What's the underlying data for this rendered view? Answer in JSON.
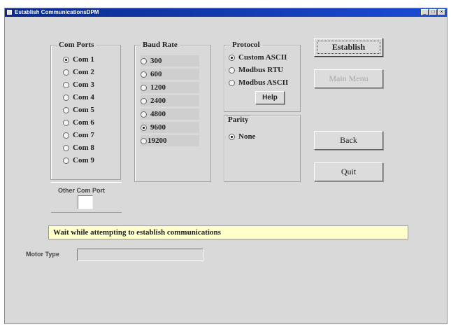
{
  "window": {
    "title": "Establish CommunicationsDPM",
    "controls": {
      "minimize": "_",
      "maximize": "□",
      "close": "×"
    }
  },
  "com_ports": {
    "label": "Com Ports",
    "items": [
      {
        "label": "Com 1",
        "checked": true
      },
      {
        "label": "Com 2",
        "checked": false
      },
      {
        "label": "Com 3",
        "checked": false
      },
      {
        "label": "Com 4",
        "checked": false
      },
      {
        "label": "Com 5",
        "checked": false
      },
      {
        "label": "Com 6",
        "checked": false
      },
      {
        "label": "Com 7",
        "checked": false
      },
      {
        "label": "Com 8",
        "checked": false
      },
      {
        "label": "Com 9",
        "checked": false
      }
    ]
  },
  "other_com_port": {
    "label": "Other Com Port",
    "value": ""
  },
  "baud_rate": {
    "label": "Baud Rate",
    "items": [
      {
        "label": "300",
        "checked": false
      },
      {
        "label": "600",
        "checked": false
      },
      {
        "label": "1200",
        "checked": false
      },
      {
        "label": "2400",
        "checked": false
      },
      {
        "label": "4800",
        "checked": false
      },
      {
        "label": "9600",
        "checked": true
      },
      {
        "label": "19200",
        "checked": false
      }
    ]
  },
  "protocol": {
    "label": "Protocol",
    "items": [
      {
        "label": "Custom ASCII",
        "checked": true
      },
      {
        "label": "Modbus RTU",
        "checked": false
      },
      {
        "label": "Modbus ASCII",
        "checked": false
      }
    ],
    "help_label": "Help"
  },
  "parity": {
    "label": "Parity",
    "items": [
      {
        "label": "None",
        "checked": true
      }
    ]
  },
  "buttons": {
    "establish": "Establish",
    "main_menu": "Main Menu",
    "back": "Back",
    "quit": "Quit"
  },
  "status": {
    "message": "Wait while attempting to establish communications"
  },
  "motor_type": {
    "label": "Motor Type",
    "value": ""
  },
  "colors": {
    "titlebar": "#1b4bd6",
    "window_bg": "#d9d9d9",
    "status_bg": "#ffffcc"
  }
}
